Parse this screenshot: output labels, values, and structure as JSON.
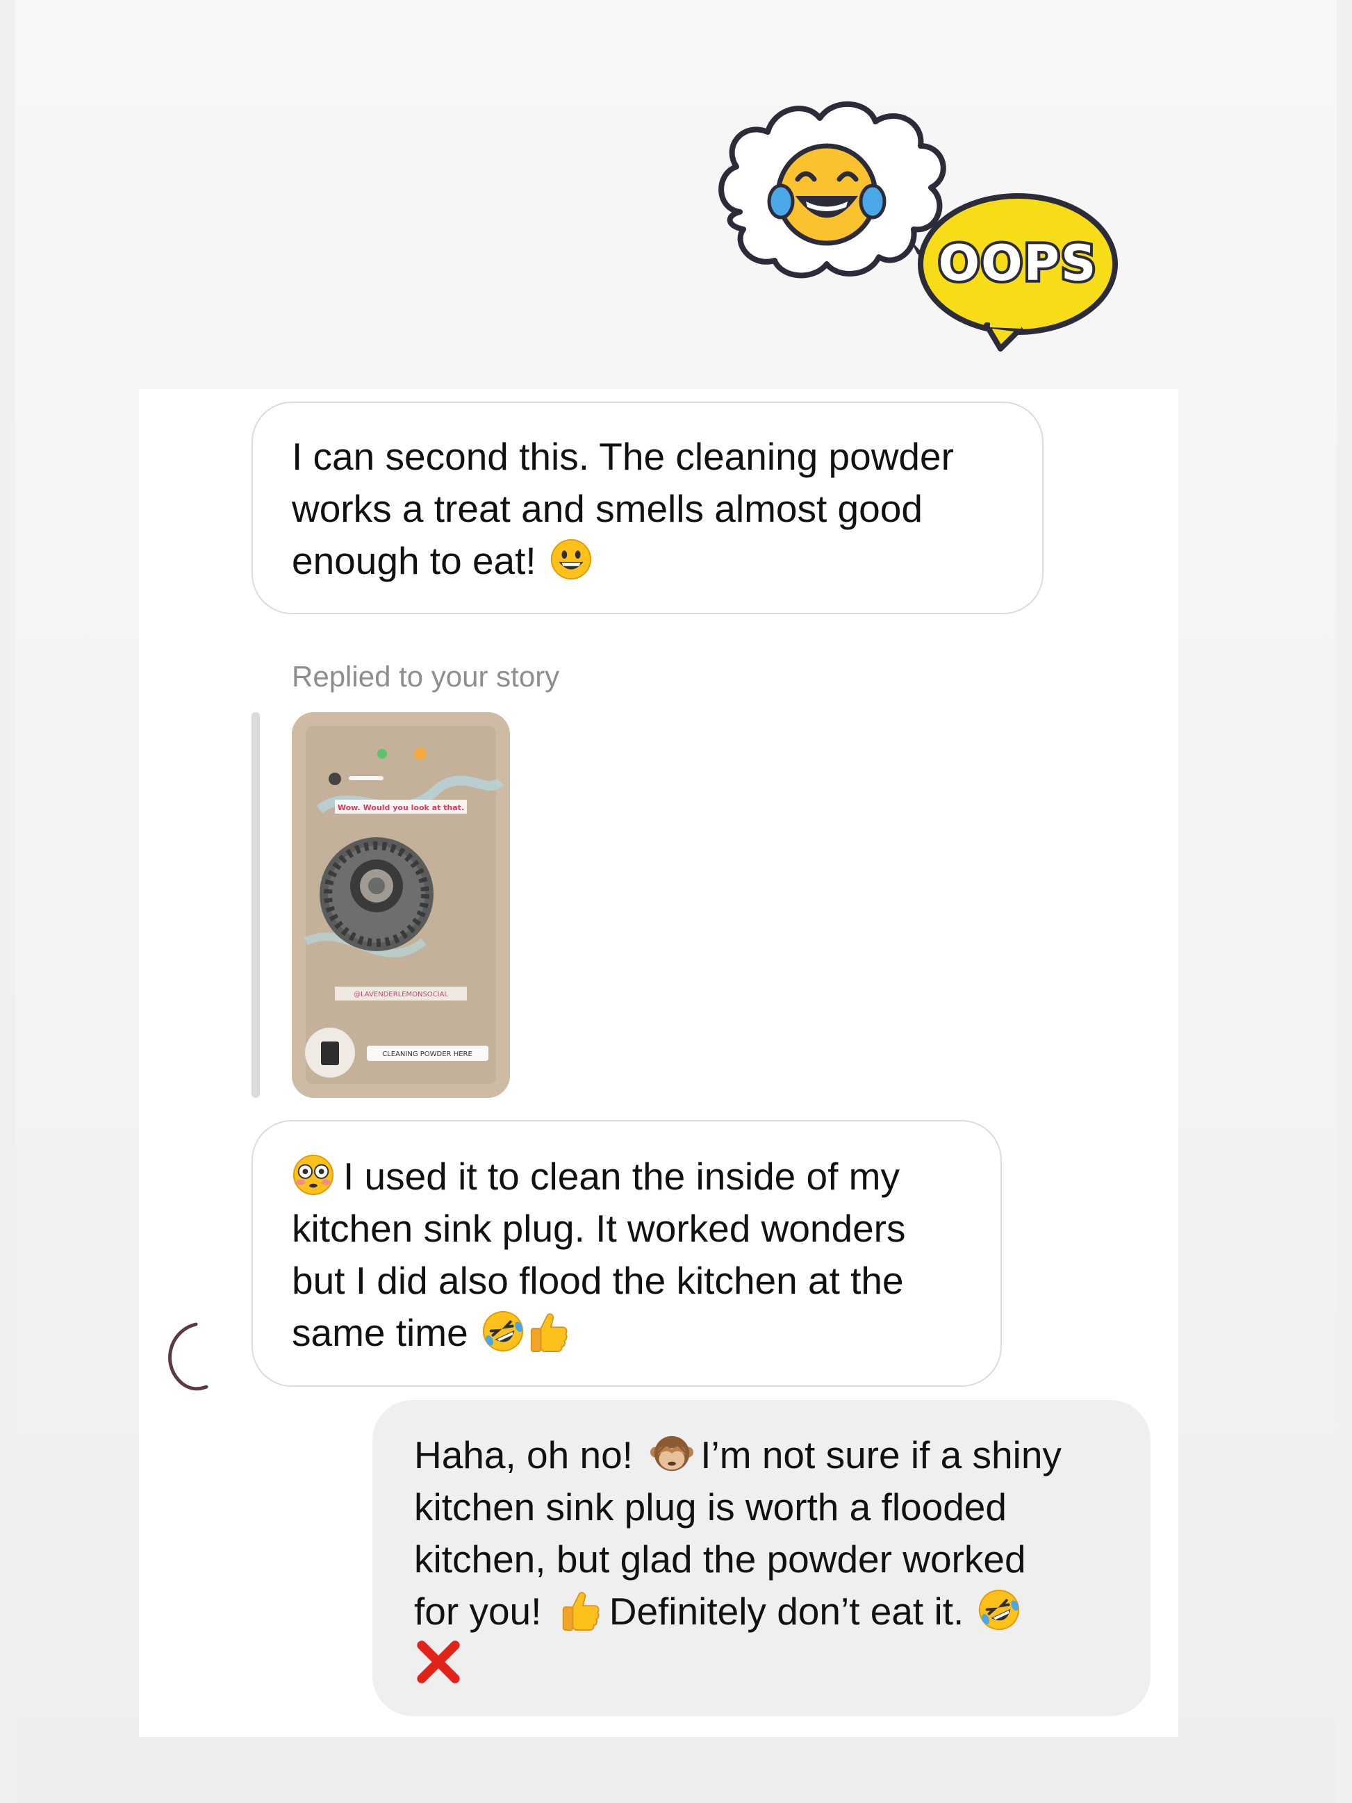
{
  "stickers": {
    "oops_text": "OOPS"
  },
  "messages": {
    "first": {
      "lines": [
        "I can second this. The cleaning powder",
        "works a treat and smells almost good",
        "enough to eat!"
      ],
      "trailing_emoji": "grinning-face"
    },
    "reply": {
      "label": "Replied to your story",
      "story_header_text": "Wow. Would you look at that.",
      "story_handle": "@LAVENDERLEMONSOCIAL",
      "story_link": "CLEANING POWDER HERE"
    },
    "second": {
      "lines": [
        "I used it to clean the inside of my",
        "kitchen sink plug. It worked wonders",
        "but I did also flood the kitchen at the",
        "same time"
      ],
      "leading_emoji": "flushed-face",
      "trailing_emojis": [
        "rolling-on-floor-laughing",
        "thumbs-up"
      ]
    },
    "own": {
      "line1_a": "Haha, oh no!",
      "line1_b": "I’m not sure if a shiny",
      "line2": "kitchen sink plug is worth a flooded",
      "line3": "kitchen, but glad the powder worked",
      "line4_a": "for you!",
      "line4_b": "Definitely don’t eat it.",
      "emojis": [
        "see-no-evil-monkey",
        "thumbs-up",
        "rolling-on-floor-laughing",
        "cross-mark"
      ]
    }
  },
  "colors": {
    "incoming_bubble": "#ffffff",
    "incoming_border": "#dbdbdb",
    "outgoing_bubble": "#efefef",
    "secondary_text": "#8e8e8e",
    "sticker_yellow": "#f7dd18",
    "cross_red": "#e2231a"
  }
}
